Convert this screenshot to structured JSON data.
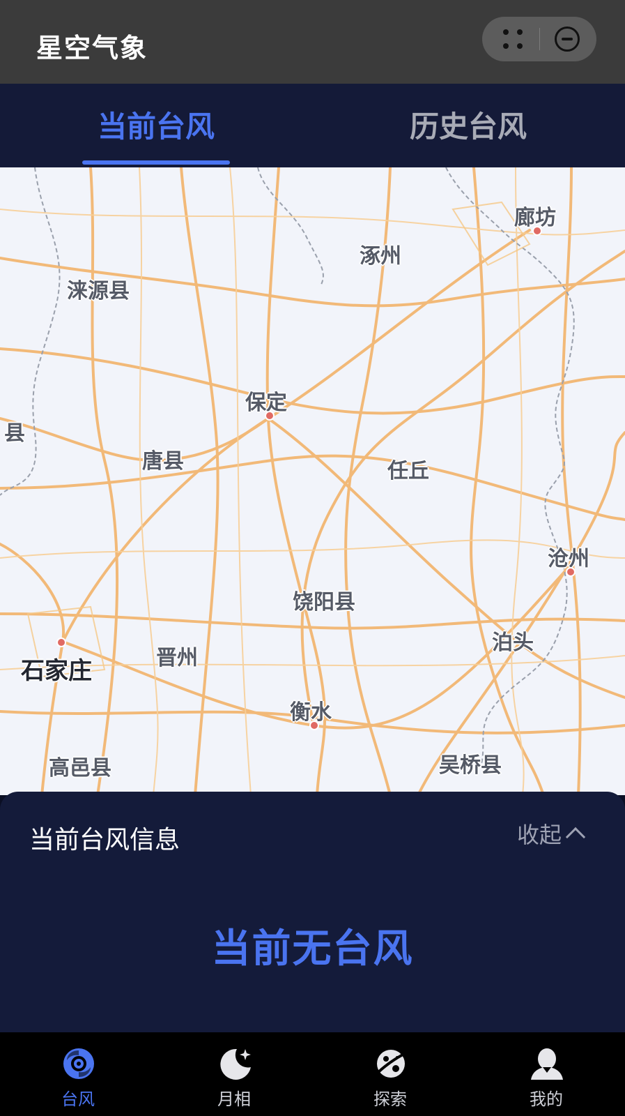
{
  "header": {
    "app_title": "星空气象"
  },
  "tabs": [
    {
      "label": "当前台风",
      "active": true
    },
    {
      "label": "历史台风",
      "active": false
    }
  ],
  "map": {
    "cities": [
      {
        "name": "廊坊",
        "type": "city"
      },
      {
        "name": "涿州",
        "type": "county"
      },
      {
        "name": "涞源县",
        "type": "county"
      },
      {
        "name": "保定",
        "type": "city"
      },
      {
        "name": "县",
        "type": "county"
      },
      {
        "name": "唐县",
        "type": "county"
      },
      {
        "name": "任丘",
        "type": "county"
      },
      {
        "name": "沧州",
        "type": "city"
      },
      {
        "name": "饶阳县",
        "type": "county"
      },
      {
        "name": "泊头",
        "type": "county"
      },
      {
        "name": "石家庄",
        "type": "capital"
      },
      {
        "name": "晋州",
        "type": "county"
      },
      {
        "name": "衡水",
        "type": "city"
      },
      {
        "name": "高邑县",
        "type": "county"
      },
      {
        "name": "吴桥县",
        "type": "county"
      }
    ]
  },
  "panel": {
    "title": "当前台风信息",
    "collapse_label": "收起",
    "empty_message": "当前无台风"
  },
  "bottom_nav": [
    {
      "label": "台风",
      "icon": "typhoon-icon",
      "active": true
    },
    {
      "label": "月相",
      "icon": "moon-icon",
      "active": false
    },
    {
      "label": "探索",
      "icon": "planet-icon",
      "active": false
    },
    {
      "label": "我的",
      "icon": "user-icon",
      "active": false
    }
  ],
  "colors": {
    "accent": "#4a74f0",
    "panel_bg": "#141b3a",
    "topbar_bg": "#3b3b3b",
    "map_road": "#f3b36a",
    "city_dot": "#e06a63"
  }
}
